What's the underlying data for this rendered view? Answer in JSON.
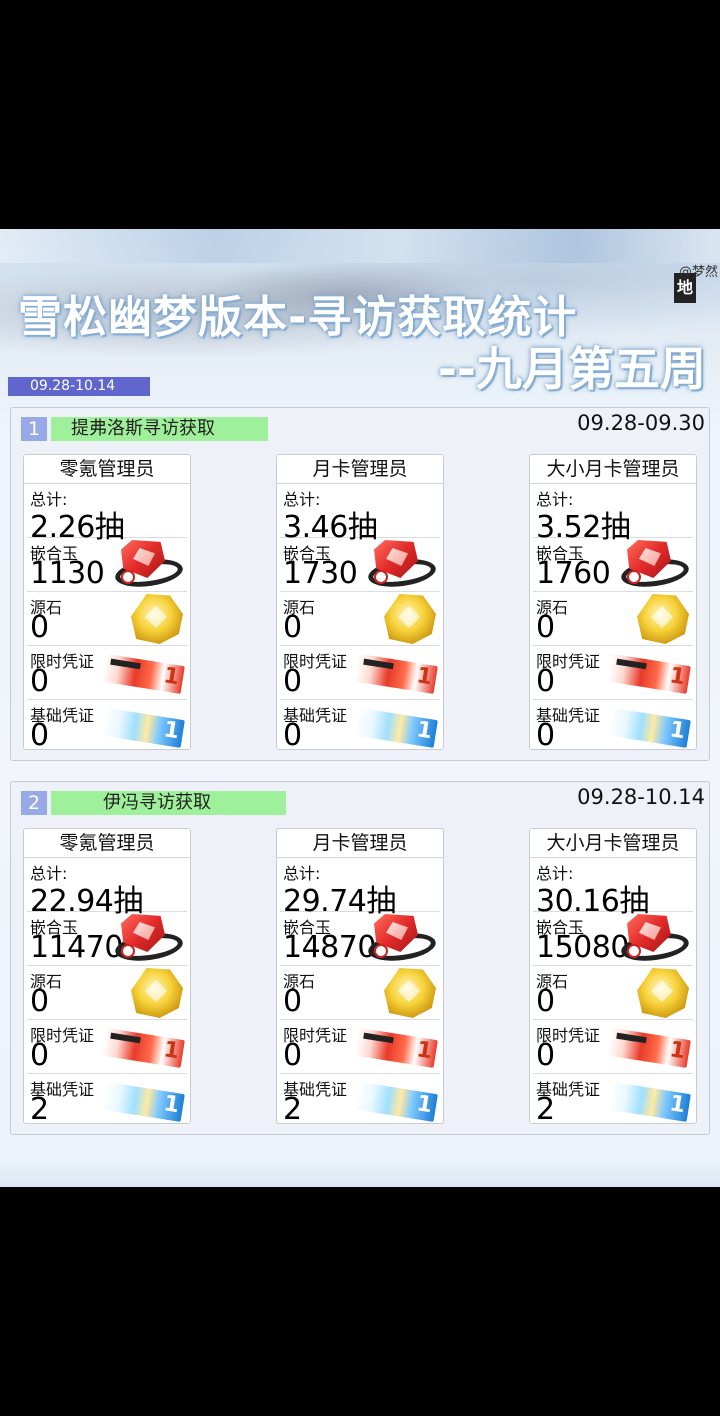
{
  "header": {
    "title_line1": "雪松幽梦版本-寻访获取统计",
    "title_line2": "--九月第五周",
    "watermark": "@梦然",
    "date_range": "09.28-10.14"
  },
  "row_labels": {
    "total": "总计:",
    "orundum": "嵌合玉",
    "originite": "源石",
    "limited_voucher": "限时凭证",
    "basic_voucher": "基础凭证"
  },
  "sections": [
    {
      "number": "1",
      "title": "提弗洛斯寻访获取",
      "date": "09.28-09.30",
      "columns": [
        {
          "name": "零氪管理员",
          "total": "2.26抽",
          "orundum": "1130",
          "originite": "0",
          "limited": "0",
          "basic": "0"
        },
        {
          "name": "月卡管理员",
          "total": "3.46抽",
          "orundum": "1730",
          "originite": "0",
          "limited": "0",
          "basic": "0"
        },
        {
          "name": "大小月卡管理员",
          "total": "3.52抽",
          "orundum": "1760",
          "originite": "0",
          "limited": "0",
          "basic": "0"
        }
      ]
    },
    {
      "number": "2",
      "title": "伊冯寻访获取",
      "date": "09.28-10.14",
      "columns": [
        {
          "name": "零氪管理员",
          "total": "22.94抽",
          "orundum": "11470",
          "originite": "0",
          "limited": "0",
          "basic": "2"
        },
        {
          "name": "月卡管理员",
          "total": "29.74抽",
          "orundum": "14870",
          "originite": "0",
          "limited": "0",
          "basic": "2"
        },
        {
          "name": "大小月卡管理员",
          "total": "30.16抽",
          "orundum": "15080",
          "originite": "0",
          "limited": "0",
          "basic": "2"
        }
      ]
    }
  ],
  "icons": {
    "orundum": "orundum-icon",
    "originite": "originite-prime-icon",
    "limited": "limited-voucher-icon",
    "basic": "basic-voucher-icon"
  },
  "colors": {
    "date_pill": "#6066cc",
    "section_title_bg": "#9ff09a",
    "number_badge": "#97a9e6"
  }
}
